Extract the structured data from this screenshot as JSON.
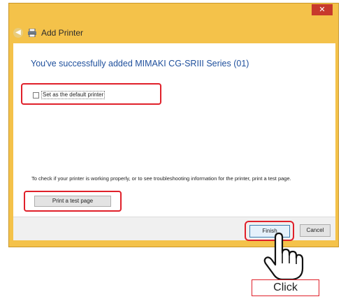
{
  "window": {
    "title": "Add Printer",
    "close_glyph": "✕"
  },
  "icons": {
    "back": "back-arrow-icon",
    "printer": "printer-icon",
    "close": "close-icon",
    "hand": "hand-pointer-icon"
  },
  "content": {
    "heading": "You've successfully added MIMAKI CG-SRIII Series (01)",
    "default_checkbox": {
      "label": "Set as the default printer",
      "checked": false
    },
    "info_text": "To check if your printer is working properly, or to see troubleshooting information for the printer, print a test page.",
    "print_test_label": "Print a test page"
  },
  "footer": {
    "finish_label": "Finish",
    "cancel_label": "Cancel"
  },
  "annotation": {
    "click_label": "Click"
  },
  "colors": {
    "frame": "#f4c24a",
    "heading": "#1e4f9c",
    "highlight": "#e0202a",
    "close_button": "#c7392c"
  }
}
